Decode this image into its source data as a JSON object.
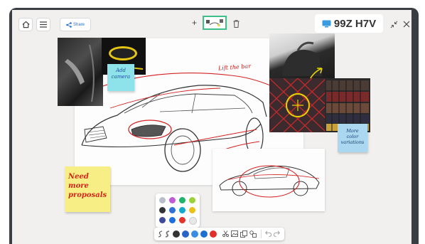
{
  "top_bar": {
    "share_label": "Share",
    "add_symbol": "+",
    "session_code": "99Z H7V"
  },
  "board": {
    "sticky_camera": "Add camera",
    "sticky_proposals": "Need more proposals",
    "sticky_colors": "More color variations",
    "sketch_note": "Lift the bar"
  },
  "palette": {
    "colors": [
      "#b9bfc9",
      "#c05ad6",
      "#1fb36b",
      "#9bd23a",
      "#333333",
      "#2f6fd8",
      "#14a8c9",
      "#e8c21b",
      "#3f4a9c",
      "#1d6fe0",
      "#e5342b",
      "#e8e8e8"
    ]
  },
  "pen_tools": {
    "pens": [
      "#333333",
      "#2a64c8",
      "#3a8de0",
      "#1f6fd0",
      "#e0302a"
    ]
  },
  "icons": [
    "home-icon",
    "menu-icon",
    "share-icon",
    "plus-icon",
    "page-thumbnail-icon",
    "trash-icon",
    "cast-icon",
    "collapse-icon",
    "close-icon",
    "pen-icon",
    "marker-icon",
    "scissors-icon",
    "image-icon",
    "copy-icon",
    "shapes-icon",
    "undo-icon",
    "redo-icon"
  ]
}
